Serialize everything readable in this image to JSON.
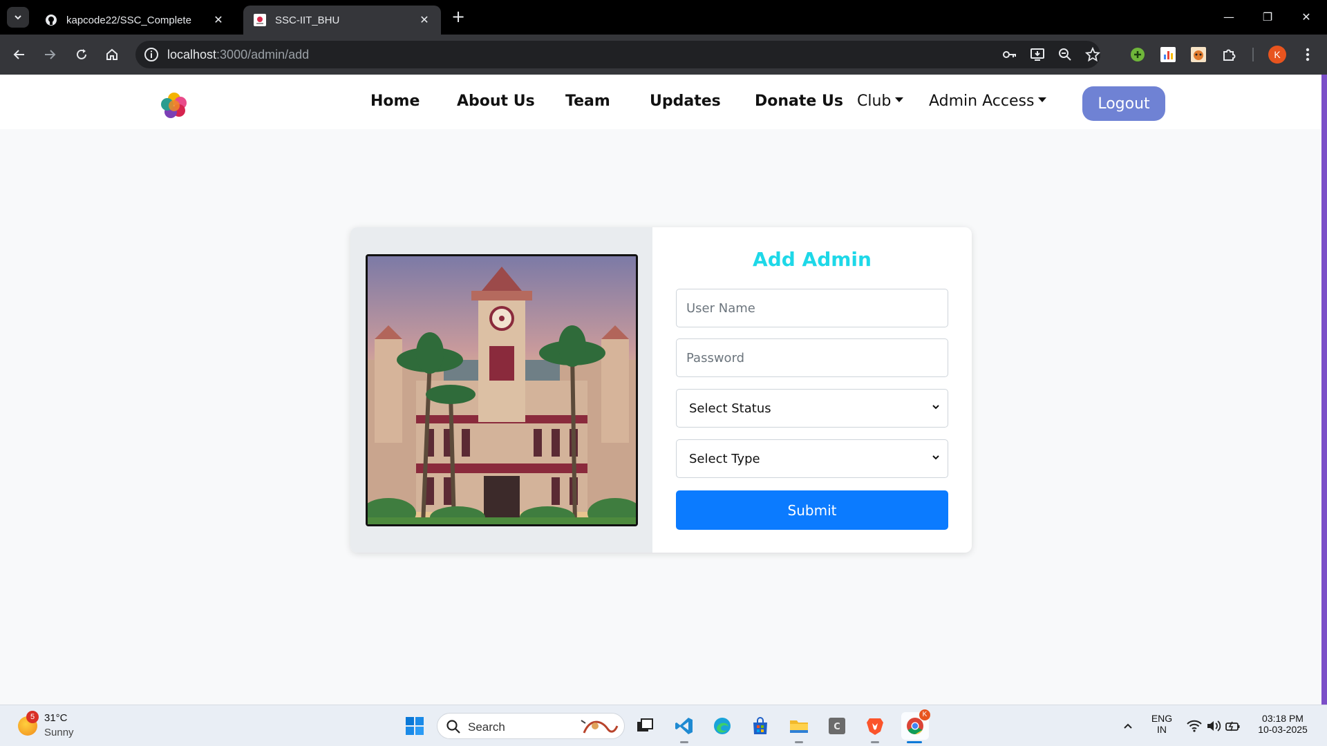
{
  "browser": {
    "tabs": [
      {
        "title": "kapcode22/SSC_Complete",
        "favicon": "github-icon",
        "active": false
      },
      {
        "title": "SSC-IIT_BHU",
        "favicon": "site-favicon",
        "active": true
      }
    ],
    "url_host": "localhost",
    "url_path": ":3000/admin/add",
    "profile_initial": "K"
  },
  "nav": {
    "links": [
      "Home",
      "About Us",
      "Team",
      "Updates",
      "Donate Us"
    ],
    "club": "Club",
    "admin_access": "Admin Access",
    "logout": "Logout"
  },
  "form": {
    "title": "Add Admin",
    "username_placeholder": "User Name",
    "password_placeholder": "Password",
    "status_select": "Select Status",
    "type_select": "Select Type",
    "submit": "Submit"
  },
  "taskbar": {
    "weather_temp": "31°C",
    "weather_desc": "Sunny",
    "weather_badge": "5",
    "search_label": "Search",
    "lang_top": "ENG",
    "lang_bottom": "IN",
    "time": "03:18 PM",
    "date": "10-03-2025",
    "chrome_badge": "K"
  },
  "colors": {
    "accent_title": "#1ed8e8",
    "submit_bg": "#0b7bff",
    "logout_bg": "#6f82d4",
    "page_bg": "#f8f9fa"
  }
}
